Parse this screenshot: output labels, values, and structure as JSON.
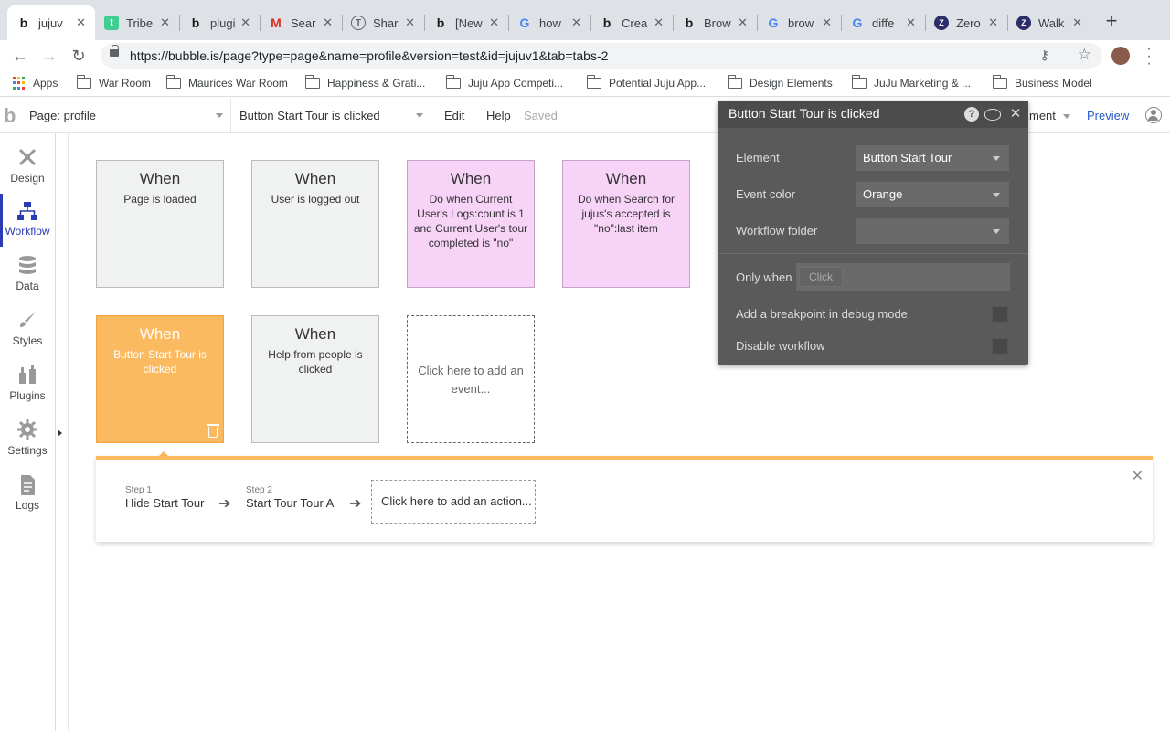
{
  "browser": {
    "tabs": [
      {
        "title": "jujuv",
        "favicon": "bubble-icon",
        "color": "#1a1a1a"
      },
      {
        "title": "Tribe",
        "favicon": "tribe-icon",
        "color": "#3ccf91"
      },
      {
        "title": "plugi",
        "favicon": "bubble-icon",
        "color": "#1a1a1a"
      },
      {
        "title": "Sear",
        "favicon": "gmail-icon",
        "color": "#d93025"
      },
      {
        "title": "Shar",
        "favicon": "t-circle-icon",
        "color": "#5f6368"
      },
      {
        "title": "[New",
        "favicon": "bubble-icon",
        "color": "#1a1a1a"
      },
      {
        "title": "how",
        "favicon": "google-icon",
        "color": "#4285f4"
      },
      {
        "title": "Crea",
        "favicon": "bubble-icon",
        "color": "#1a1a1a"
      },
      {
        "title": "Brow",
        "favicon": "bubble-icon",
        "color": "#1a1a1a"
      },
      {
        "title": "brow",
        "favicon": "google-icon",
        "color": "#4285f4"
      },
      {
        "title": "diffe",
        "favicon": "google-icon",
        "color": "#4285f4"
      },
      {
        "title": "Zero",
        "favicon": "zero-icon",
        "color": "#2d2d6a"
      },
      {
        "title": "Walk",
        "favicon": "zero-icon",
        "color": "#2d2d6a"
      }
    ],
    "url": "https://bubble.is/page?type=page&name=profile&version=test&id=jujuv1&tab=tabs-2",
    "bookmarks": [
      "Apps",
      "War Room",
      "Maurices War Room",
      "Happiness & Grati...",
      "Juju App Competi...",
      "Potential Juju App...",
      "Design Elements",
      "JuJu Marketing & ...",
      "Business Model"
    ]
  },
  "editor": {
    "page_select": "Page: profile",
    "event_select": "Button Start Tour is clicked",
    "menu": {
      "edit": "Edit",
      "help": "Help"
    },
    "status": "Saved",
    "right_partial": "ment",
    "preview": "Preview"
  },
  "sidebar": {
    "items": [
      {
        "label": "Design",
        "icon": "design-icon"
      },
      {
        "label": "Workflow",
        "icon": "workflow-icon",
        "active": true
      },
      {
        "label": "Data",
        "icon": "database-icon"
      },
      {
        "label": "Styles",
        "icon": "brush-icon"
      },
      {
        "label": "Plugins",
        "icon": "plugins-icon"
      },
      {
        "label": "Settings",
        "icon": "gear-icon"
      },
      {
        "label": "Logs",
        "icon": "document-icon"
      }
    ]
  },
  "events": [
    {
      "when": "When",
      "desc": "Page is loaded",
      "color": "gray"
    },
    {
      "when": "When",
      "desc": "User is logged out",
      "color": "gray"
    },
    {
      "when": "When",
      "desc": "Do when Current User's Logs:count is 1 and Current User's tour completed is \"no\"",
      "color": "pink"
    },
    {
      "when": "When",
      "desc": "Do when Search for jujus's accepted is \"no\":last item",
      "color": "pink"
    },
    {
      "when": "When",
      "desc": "Button Start Tour is clicked",
      "color": "orange"
    },
    {
      "when": "When",
      "desc": "Help from people is clicked",
      "color": "gray"
    }
  ],
  "add_event": "Click here to add an event...",
  "workflow": {
    "steps": [
      {
        "num": "Step 1",
        "name": "Hide Start Tour"
      },
      {
        "num": "Step 2",
        "name": "Start Tour Tour A"
      }
    ],
    "add_action": "Click here to add an action..."
  },
  "panel": {
    "title": "Button Start Tour is clicked",
    "element_label": "Element",
    "element_value": "Button Start Tour",
    "color_label": "Event color",
    "color_value": "Orange",
    "folder_label": "Workflow folder",
    "folder_value": "",
    "only_when_label": "Only when",
    "only_when_placeholder": "Click",
    "breakpoint_label": "Add a breakpoint in debug mode",
    "disable_label": "Disable workflow"
  },
  "colors": {
    "accent": "#2b3ab5",
    "orange": "#fbb960",
    "pink": "#f8d3f8",
    "link": "#2b58c9"
  }
}
